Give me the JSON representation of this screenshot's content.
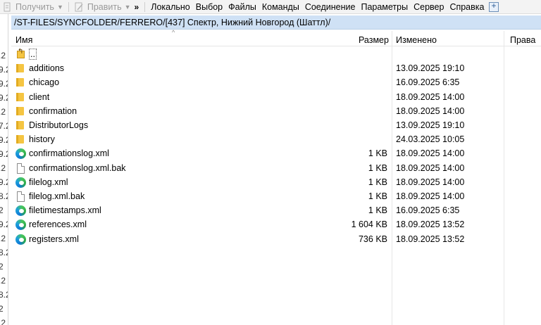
{
  "toolbar": {
    "get_label": "Получить",
    "edit_label": "Править",
    "overflow": "»",
    "menu": [
      "Локально",
      "Выбор",
      "Файлы",
      "Команды",
      "Соединение",
      "Параметры",
      "Сервер",
      "Справка"
    ]
  },
  "left_panel_fragments": [
    ".2",
    "9.2",
    "9.2",
    "9.2",
    ".2",
    "7.2",
    "9.2",
    "9.2",
    ".2",
    "9.2",
    "8.2",
    "2",
    "9.2",
    ".2",
    "8.2",
    "2",
    ".2",
    "8.2",
    "2",
    ".2",
    "2"
  ],
  "path": "/ST-FILES/SYNCFOLDER/FERRERO/[437] Спектр, Нижний Новгород (Шаттл)/",
  "columns": {
    "name": "Имя",
    "size": "Размер",
    "modified": "Изменено",
    "rights": "Права"
  },
  "sort_indicator": "^",
  "files": [
    {
      "icon": "parent-dir-icon",
      "name": "..",
      "size": "",
      "modified": ""
    },
    {
      "icon": "folder-icon",
      "name": "additions",
      "size": "",
      "modified": "13.09.2025 19:10"
    },
    {
      "icon": "folder-icon",
      "name": "chicago",
      "size": "",
      "modified": "16.09.2025 6:35"
    },
    {
      "icon": "folder-icon",
      "name": "client",
      "size": "",
      "modified": "18.09.2025 14:00"
    },
    {
      "icon": "folder-icon",
      "name": "confirmation",
      "size": "",
      "modified": "18.09.2025 14:00"
    },
    {
      "icon": "folder-icon",
      "name": "DistributorLogs",
      "size": "",
      "modified": "13.09.2025 19:10"
    },
    {
      "icon": "folder-icon",
      "name": "history",
      "size": "",
      "modified": "24.03.2025 10:05"
    },
    {
      "icon": "edge-icon",
      "name": "confirmationslog.xml",
      "size": "1 KB",
      "modified": "18.09.2025 14:00"
    },
    {
      "icon": "file-icon",
      "name": "confirmationslog.xml.bak",
      "size": "1 KB",
      "modified": "18.09.2025 14:00"
    },
    {
      "icon": "edge-icon",
      "name": "filelog.xml",
      "size": "1 KB",
      "modified": "18.09.2025 14:00"
    },
    {
      "icon": "file-icon",
      "name": "filelog.xml.bak",
      "size": "1 KB",
      "modified": "18.09.2025 14:00"
    },
    {
      "icon": "edge-icon",
      "name": "filetimestamps.xml",
      "size": "1 KB",
      "modified": "16.09.2025 6:35"
    },
    {
      "icon": "edge-icon",
      "name": "references.xml",
      "size": "1 604 KB",
      "modified": "18.09.2025 13:52"
    },
    {
      "icon": "edge-icon",
      "name": "registers.xml",
      "size": "736 KB",
      "modified": "18.09.2025 13:52"
    }
  ],
  "colors": {
    "path_bar_bg": "#cfe1f5",
    "folder": "#f5c542",
    "toolbar_disabled_text": "#9a9a9a"
  }
}
